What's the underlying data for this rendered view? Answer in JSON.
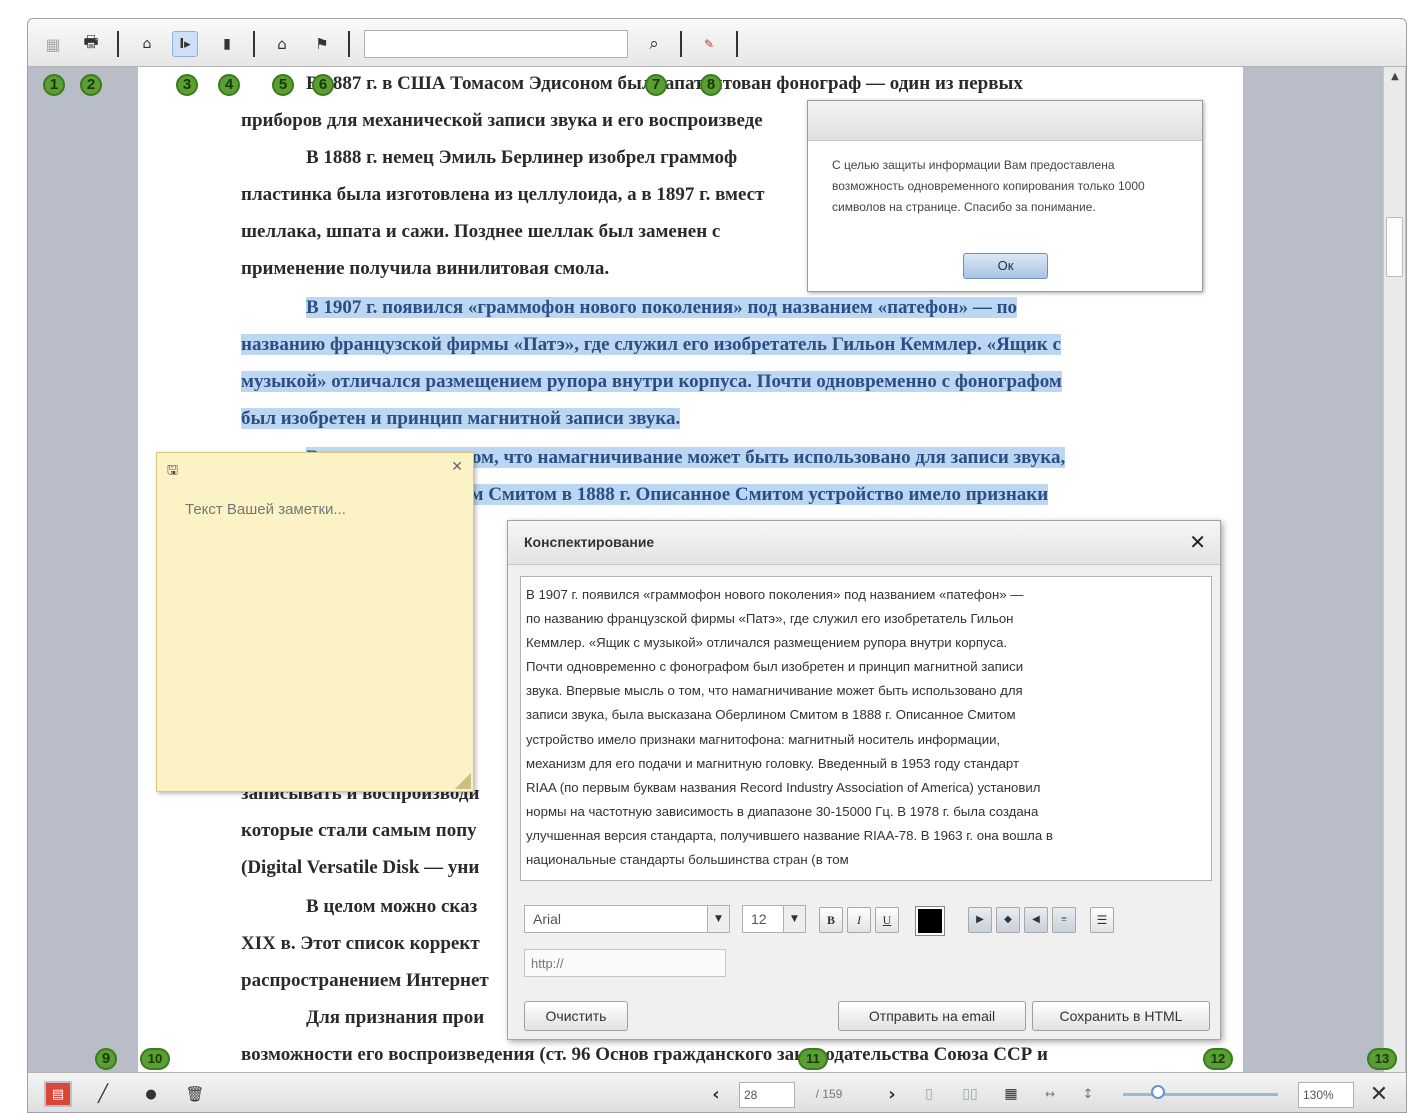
{
  "toolbar": {
    "icons": [
      "thumbnails-icon",
      "print-icon",
      "home-icon",
      "text-select-icon",
      "page-icon",
      "library-icon",
      "bookmark-icon",
      "search-icon",
      "highlight-icon"
    ],
    "search_value": ""
  },
  "page_text": {
    "p1": "В 1887 г. в США Томасом Эдисоном был запатентован фонограф — один из первых",
    "p2": "приборов для механической записи звука и его воспроизведе",
    "p3": "В 1888 г. немец Эмиль Берлинер изобрел граммоф",
    "p4": "пластинка была изготовлена из целлулоида, а в 1897 г. вмест",
    "p5": "шеллака, шпата и сажи. Позднее шеллак был заменен с",
    "p6": "применение получила винилитовая смола.",
    "p7": "В 1907 г. появился «граммофон нового поколения» под названием «патефон» — по",
    "p8": "названию французской фирмы «Патэ», где служил его изобретатель Гильон Кеммлер. «Ящик с",
    "p9": "музыкой» отличался размещением рупора внутри корпуса. Почти одновременно с фонографом",
    "p10": "был изобретен и принцип магнитной записи звука.",
    "p11": "Впервые мысль о том, что намагничивание может быть использовано для записи звука,",
    "p12": "была высказана Оберлином Смитом в 1888 г. Описанное Смитом устройство имело признаки",
    "p13": "записывать и воспроизводи",
    "p14": "которые стали самым попу",
    "p15": "(Digital Versatile Disk — уни",
    "p16": "В целом можно сказ",
    "p17": "XIX в. Этот список коррект",
    "p18": "распространением Интернет",
    "p19": "Для признания прои",
    "p20": "возможности его воспроизведения (ст. 96 Основ гражданского законодательства Союза ССР и"
  },
  "alert": {
    "message": "С целью защиты информации Вам предоставлена возможность одновременного копирования только 1000 символов на странице. Спасибо за понимание.",
    "ok_label": "Ок"
  },
  "note": {
    "placeholder": "Текст Вашей заметки..."
  },
  "summary_dialog": {
    "title": "Конспектирование",
    "lines": [
      "В 1907 г. появился «граммофон нового поколения» под названием «патефон» —",
      "по названию французской фирмы «Патэ», где служил его изобретатель Гильон",
      "Кеммлер. «Ящик с музыкой» отличался размещением рупора внутри корпуса.",
      "Почти одновременно с фонографом был изобретен и принцип магнитной записи",
      "звука.  Впервые мысль о том, что намагничивание может быть использовано для",
      "записи звука, была высказана Оберлином Смитом в 1888 г. Описанное Смитом",
      "устройство имело признаки магнитофона: магнитный носитель информации,",
      "механизм для его подачи и магнитную головку.  Введенный в 1953 году стандарт",
      "RIAA (по первым буквам названия Record Industry Association of America) установил",
      "нормы на частотную зависимость в диапазоне 30-15000 Гц.  В 1978 г. была создана",
      "улучшенная версия стандарта, получившего название RIAA-78. В 1963 г. она вошла в",
      "национальные стандарты большинства стран (в том"
    ],
    "font_value": "Arial",
    "size_value": "12",
    "bold": "B",
    "italic": "I",
    "underline": "U",
    "text_color": "#000000",
    "url_placeholder": "http://",
    "clear_label": "Очистить",
    "email_label": "Отправить на email",
    "save_label": "Сохранить в HTML"
  },
  "pager": {
    "current_page": "28",
    "total_pages": "/ 159",
    "zoom": "130%",
    "zoom_level": 0.23
  },
  "markers": [
    "1",
    "2",
    "3",
    "4",
    "5",
    "6",
    "7",
    "8",
    "9",
    "10",
    "11",
    "12",
    "13"
  ],
  "colors": {
    "highlight": "#bcd6f3",
    "note_bg": "#fbf3c6",
    "marker": "#5a9f33",
    "viewer_bg": "#b8bdc8"
  }
}
